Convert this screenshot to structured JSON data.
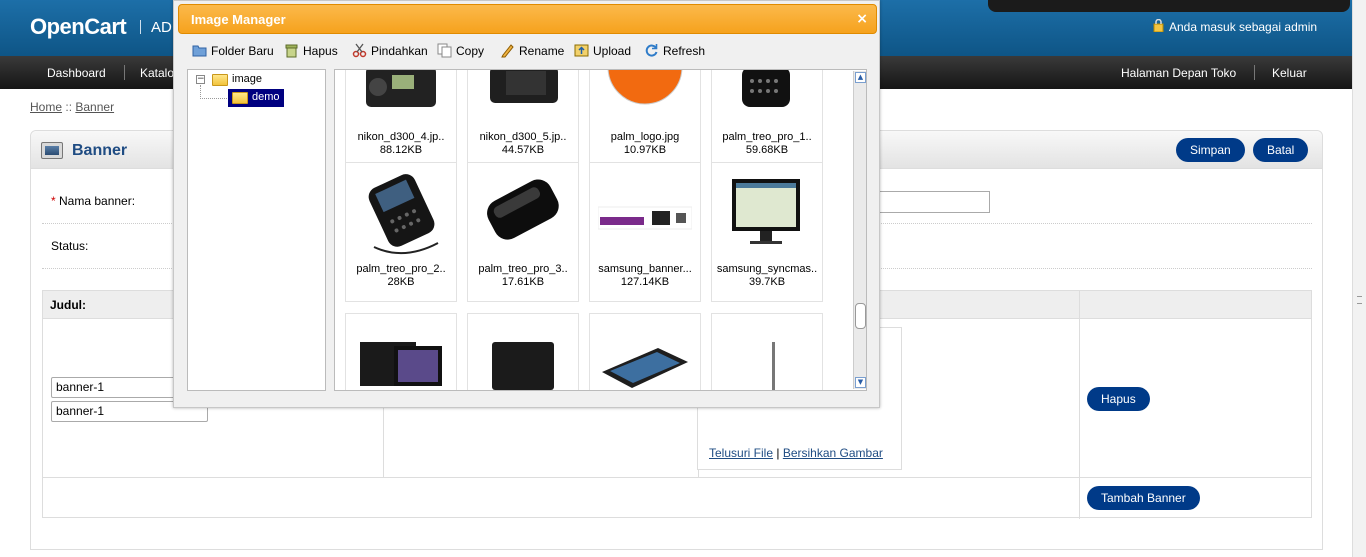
{
  "header": {
    "logo": "OpenCart",
    "logo_sub": "AD",
    "login_text": "Anda masuk sebagai admin"
  },
  "menu": {
    "left": [
      "Dashboard",
      "Katalog"
    ],
    "right": [
      "Halaman Depan Toko",
      "Keluar"
    ]
  },
  "breadcrumb": {
    "home": "Home",
    "sep": "::",
    "current": "Banner"
  },
  "page": {
    "title": "Banner",
    "save_label": "Simpan",
    "cancel_label": "Batal",
    "name_label": "Nama banner:",
    "required_mark": "*",
    "status_label": "Status:",
    "table": {
      "col_title": "Judul:",
      "rows": [
        {
          "title_values": [
            "banner-1",
            "banner-1"
          ],
          "delete_label": "Hapus"
        }
      ],
      "browse_label": "Telusuri File",
      "link_sep": "|",
      "clear_label": "Bersihkan Gambar",
      "add_label": "Tambah Banner"
    }
  },
  "dialog": {
    "title": "Image Manager",
    "close": "×",
    "toolbar": [
      {
        "label": "Folder Baru",
        "icon": "folder-new-icon"
      },
      {
        "label": "Hapus",
        "icon": "trash-icon"
      },
      {
        "label": "Pindahkan",
        "icon": "scissors-icon"
      },
      {
        "label": "Copy",
        "icon": "copy-icon"
      },
      {
        "label": "Rename",
        "icon": "pencil-icon"
      },
      {
        "label": "Upload",
        "icon": "upload-icon"
      },
      {
        "label": "Refresh",
        "icon": "refresh-icon"
      }
    ],
    "tree": {
      "expander": "−",
      "root": "image",
      "child": "demo"
    },
    "files": [
      {
        "name": "nikon_d300_4.jp..",
        "size": "88.12KB"
      },
      {
        "name": "nikon_d300_5.jp..",
        "size": "44.57KB"
      },
      {
        "name": "palm_logo.jpg",
        "size": "10.97KB"
      },
      {
        "name": "palm_treo_pro_1..",
        "size": "59.68KB"
      },
      {
        "name": "palm_treo_pro_2..",
        "size": "28KB"
      },
      {
        "name": "palm_treo_pro_3..",
        "size": "17.61KB"
      },
      {
        "name": "samsung_banner...",
        "size": "127.14KB"
      },
      {
        "name": "samsung_syncmas..",
        "size": "39.7KB"
      },
      {
        "name": "",
        "size": ""
      },
      {
        "name": "",
        "size": ""
      },
      {
        "name": "",
        "size": ""
      },
      {
        "name": "",
        "size": ""
      }
    ]
  },
  "colors": {
    "header_blue": "#0e5586",
    "button_blue": "#003a88",
    "dialog_orange": "#f6a21d",
    "tree_selected": "#000080"
  }
}
